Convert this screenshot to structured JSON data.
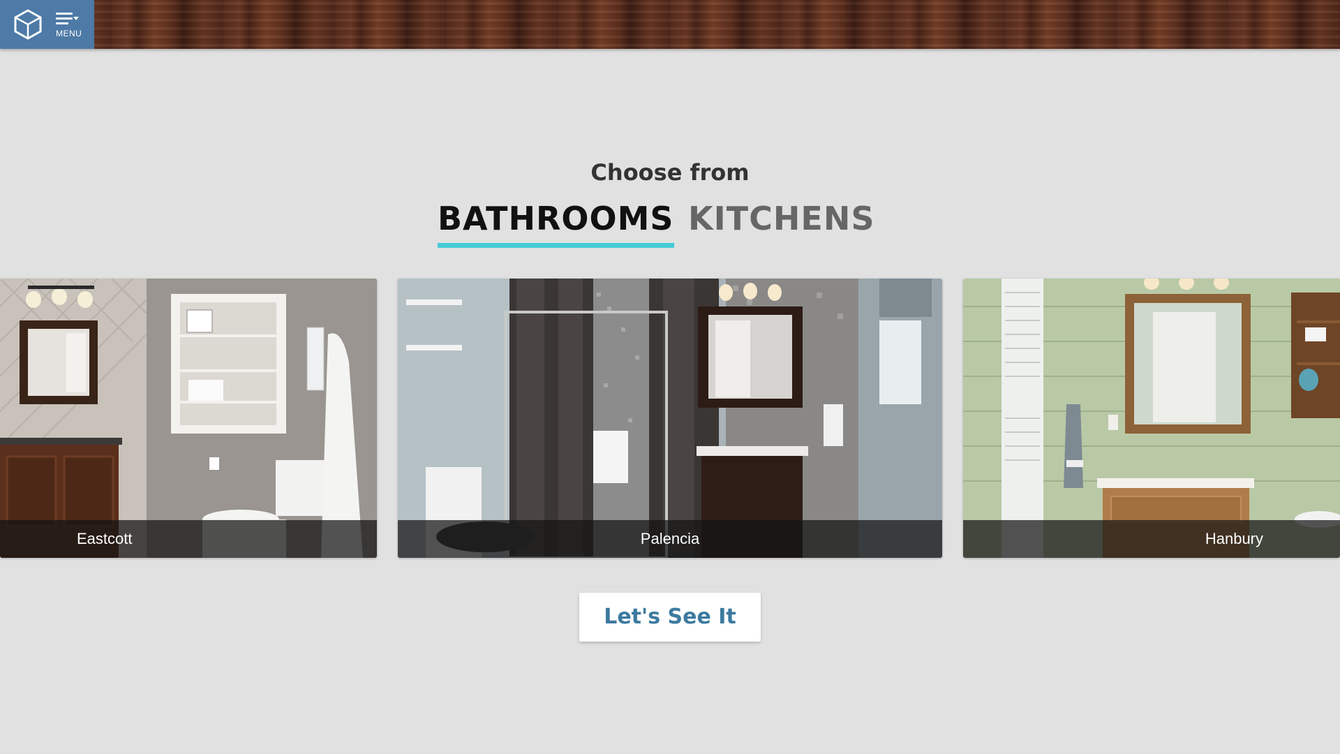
{
  "header": {
    "menu_label": "MENU"
  },
  "main": {
    "heading": "Choose from",
    "tabs": [
      {
        "label": "BATHROOMS",
        "active": true
      },
      {
        "label": "KITCHENS",
        "active": false
      }
    ],
    "cards": [
      {
        "name": "Eastcott"
      },
      {
        "name": "Palencia"
      },
      {
        "name": "Hanbury"
      }
    ],
    "cta_label": "Let's See It"
  },
  "colors": {
    "brand_blue": "#4d7aa6",
    "active_tab_underline": "#45cbd6",
    "cta_text": "#3c7a9e",
    "background": "#e1e1e1"
  }
}
